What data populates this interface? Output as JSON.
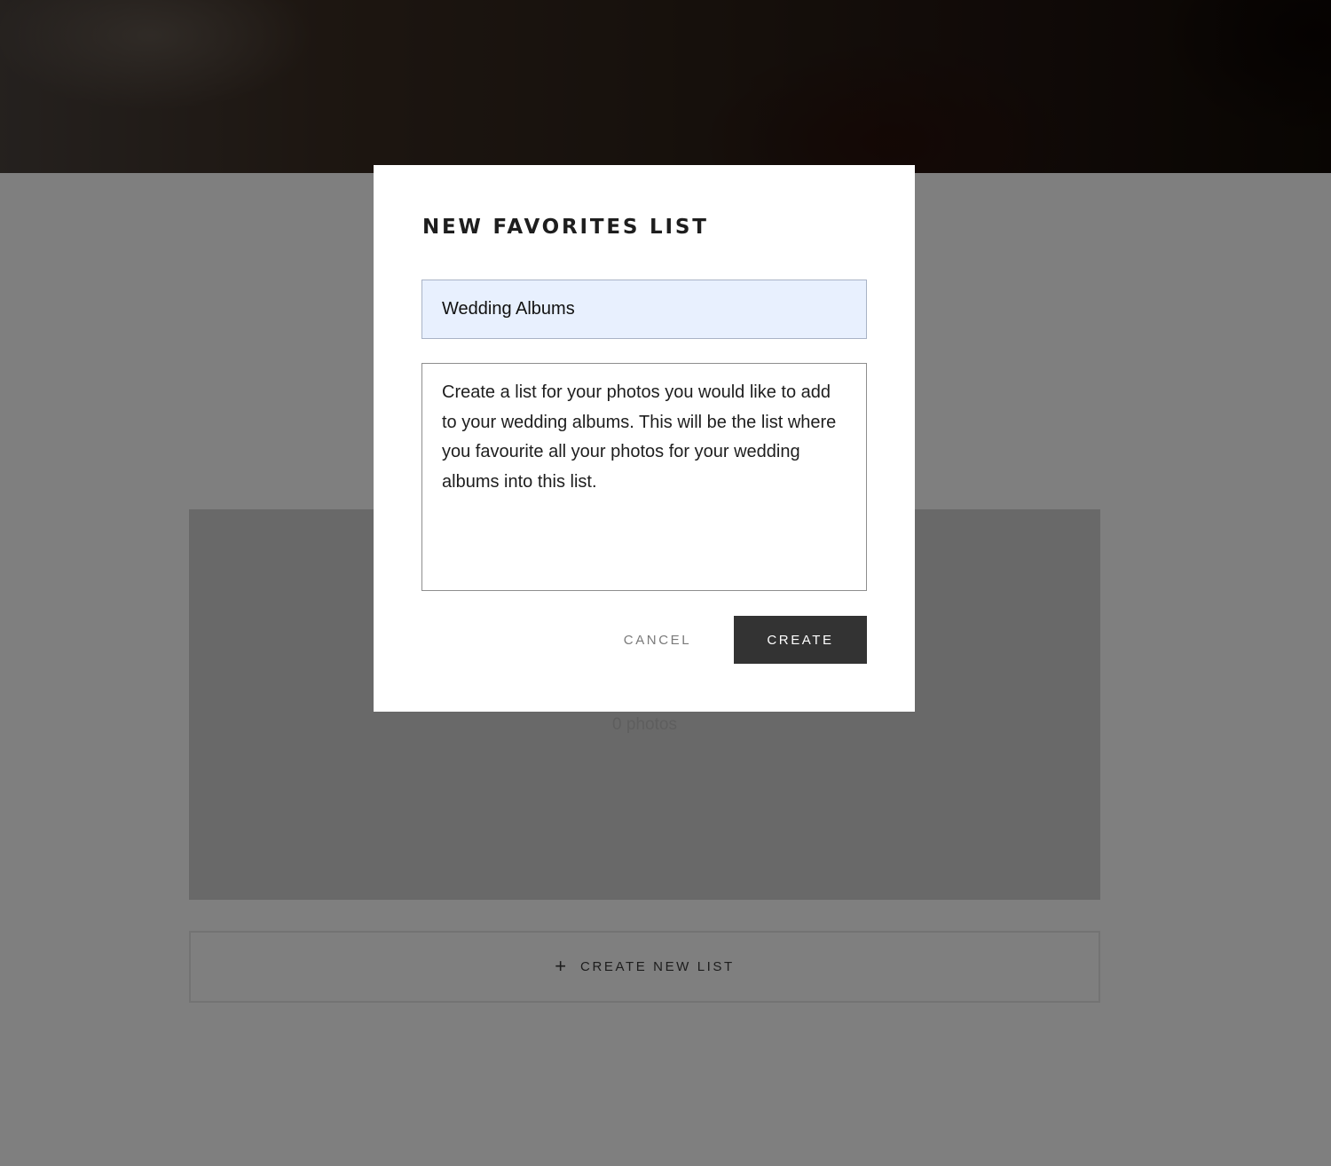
{
  "page": {
    "list_card": {
      "photo_count": "0 photos"
    },
    "create_new_list": {
      "icon": "plus-icon",
      "icon_glyph": "+",
      "label": "CREATE NEW LIST"
    }
  },
  "modal": {
    "title": "NEW FAVORITES LIST",
    "name_field": {
      "value": "Wedding Albums"
    },
    "description_field": {
      "value": "Create a list for your photos you would like to add to your wedding albums. This will be the list where you favourite all your photos for your wedding albums into this list."
    },
    "cancel_label": "CANCEL",
    "create_label": "CREATE"
  },
  "colors": {
    "overlay": "#000000",
    "primary_button": "#333333",
    "autofill_input": "#e8f0fe"
  }
}
